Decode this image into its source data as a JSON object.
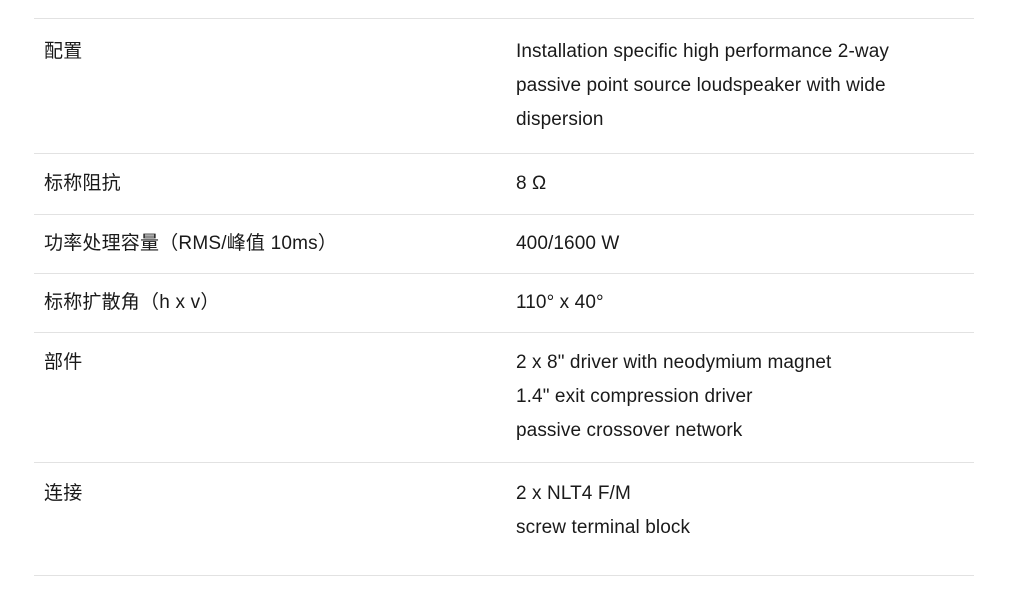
{
  "table": {
    "divider_color": "#e2e2e2",
    "text_color": "#1a1a1a",
    "background_color": "#ffffff",
    "rows": [
      {
        "key": "config",
        "label": "配置",
        "value_lines": [
          "Installation specific high performance 2-way passive point source loudspeaker with wide dispersion"
        ]
      },
      {
        "key": "impedance",
        "label": "标称阻抗",
        "value_lines": [
          "8 Ω"
        ]
      },
      {
        "key": "power",
        "label": "功率处理容量（RMS/峰值 10ms）",
        "value_lines": [
          "400/1600 W"
        ]
      },
      {
        "key": "dispersion",
        "label": "标称扩散角（h x v）",
        "value_lines": [
          "110° x 40°"
        ]
      },
      {
        "key": "components",
        "label": "部件",
        "value_lines": [
          "2 x 8\" driver with neodymium magnet",
          "1.4\" exit compression driver",
          "passive crossover network"
        ]
      },
      {
        "key": "connections",
        "label": "连接",
        "value_lines": [
          "2 x NLT4 F/M",
          "screw terminal block"
        ]
      }
    ]
  }
}
